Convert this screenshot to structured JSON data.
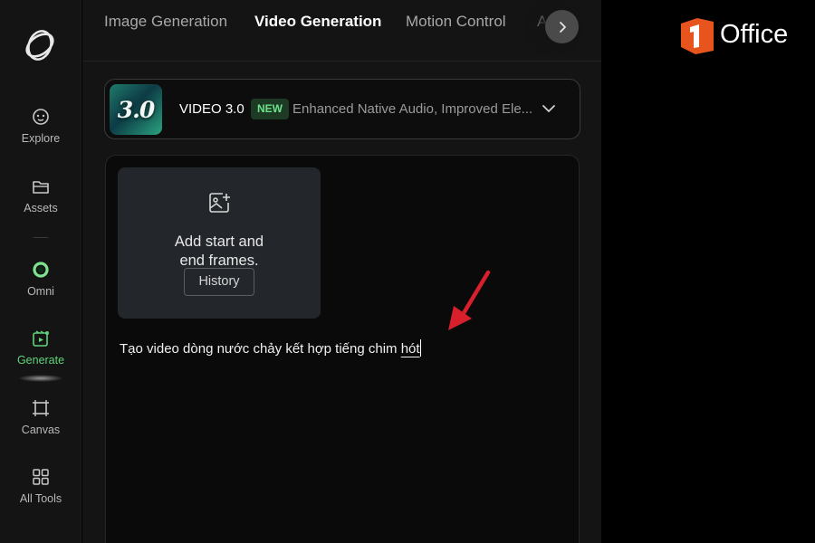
{
  "rail": {
    "items": [
      {
        "label": "Explore",
        "icon": "explore-icon"
      },
      {
        "label": "Assets",
        "icon": "folder-icon"
      },
      {
        "label": "Omni",
        "icon": "omni-ring-icon"
      },
      {
        "label": "Generate",
        "icon": "generate-icon",
        "active": true
      },
      {
        "label": "Canvas",
        "icon": "canvas-frame-icon"
      },
      {
        "label": "All Tools",
        "icon": "grid-icon"
      }
    ]
  },
  "tabs": [
    {
      "label": "Image Generation"
    },
    {
      "label": "Video Generation",
      "active": true
    },
    {
      "label": "Motion Control"
    },
    {
      "label": "A"
    }
  ],
  "model": {
    "thumb_text": "3.0",
    "name": "VIDEO 3.0",
    "badge": "NEW",
    "description": "Enhanced Native Audio, Improved Ele..."
  },
  "frames": {
    "label": "Add start and end frames.",
    "history": "History"
  },
  "prompt": {
    "text_main": "Tạo video dòng nước chảy kết hợp tiếng chim ",
    "text_last": "hót"
  },
  "brand": {
    "text": "Office",
    "color": "#e8541e"
  },
  "colors": {
    "accent": "#5fd37a",
    "arrow": "#d8202c"
  }
}
